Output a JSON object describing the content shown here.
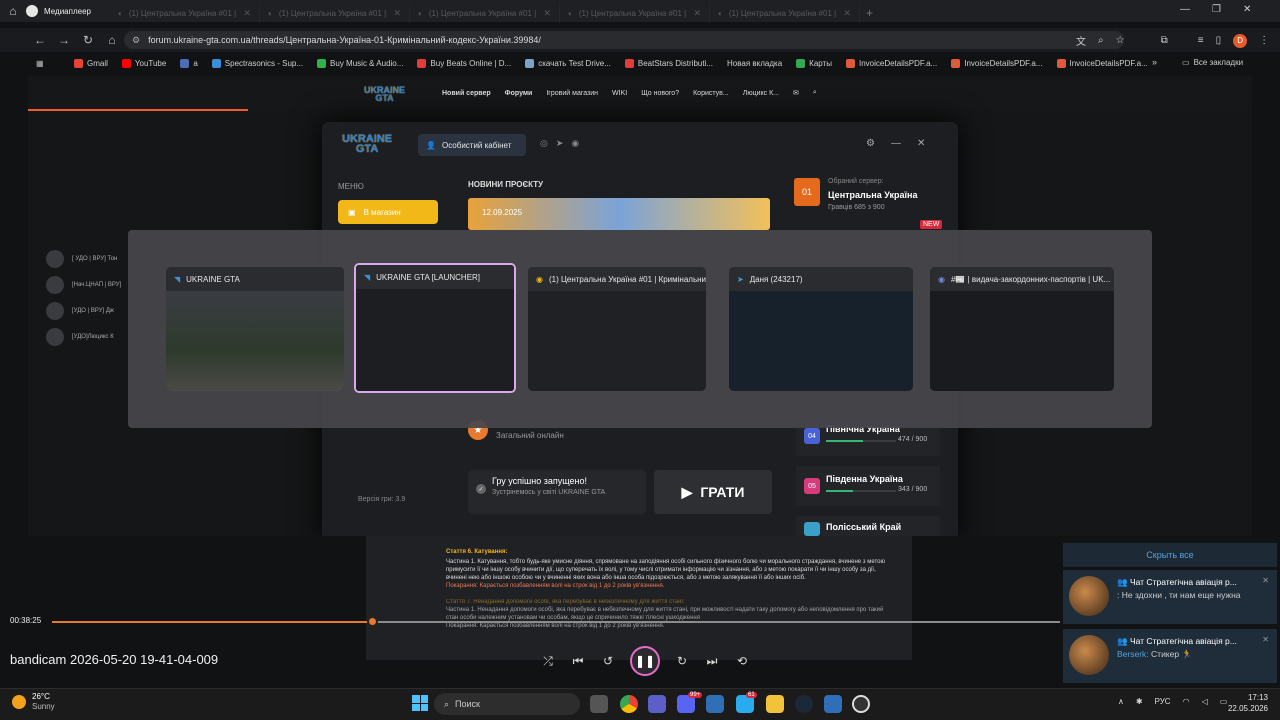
{
  "media_player": {
    "app_title": "Медиаплеер",
    "file_title": "bandicam 2026-05-20 19-41-04-009",
    "elapsed": "00:38:25",
    "progress_fraction": 0.317
  },
  "browser": {
    "tabs": [
      {
        "label": "(1) Центральна Україна #01 |"
      },
      {
        "label": "(1) Центральна Україна #01 |"
      },
      {
        "label": "(1) Центральна Україна #01 |"
      },
      {
        "label": "(1) Центральна Україна #01 |"
      },
      {
        "label": "(1) Центральна Україна #01 |"
      }
    ],
    "url": "forum.ukraine-gta.com.ua/threads/Центральна-Україна-01-Кримінальний-кодекс-України.39984/",
    "bookmarks": [
      {
        "label": "Gmail",
        "color": "#ea4335"
      },
      {
        "label": "YouTube",
        "color": "#ff0000"
      },
      {
        "label": "a",
        "color": "#4b6cb7"
      },
      {
        "label": "Spectrasonics - Sup...",
        "color": "#3a8fd8"
      },
      {
        "label": "Buy Music & Audio...",
        "color": "#2fb34a"
      },
      {
        "label": "Buy Beats Online | D...",
        "color": "#e23b3b"
      },
      {
        "label": "скачать Test Drive...",
        "color": "#7aa4c8"
      },
      {
        "label": "BeatStars Distributi...",
        "color": "#e23b3b"
      },
      {
        "label": "Новая вкладка",
        "color": ""
      },
      {
        "label": "Карты",
        "color": "#34a853"
      },
      {
        "label": "InvoiceDetailsPDF.a...",
        "color": "#e05a3a"
      },
      {
        "label": "InvoiceDetailsPDF.a...",
        "color": "#e05a3a"
      },
      {
        "label": "InvoiceDetailsPDF.a...",
        "color": "#e05a3a"
      }
    ],
    "all_bookmarks": "Все закладки",
    "profile_initial": "D"
  },
  "forum": {
    "logo_line1": "UKRAINE",
    "logo_line2": "GTA",
    "nav": [
      "Новий сервер",
      "Форуми",
      "Ігровий магазин",
      "WIKI",
      "Що нового?",
      "Користув...",
      "Люцикс К..."
    ],
    "members": [
      {
        "name": "[ УДО | ВРУ] Тон"
      },
      {
        "name": "[Нач.ЦНАП | ВРУ]"
      },
      {
        "name": "[УДО | ВРУ] Дж"
      },
      {
        "name": "[УДО]Люцикс К"
      }
    ],
    "version": "Версія гри: 3.9",
    "doc": {
      "art6_title": "Стаття 6. Катування:",
      "art6_p1": "Частина 1. Катування, тобто будь-яке умисне діяння, спрямоване на заподіяння особі сильного фізичного болю чи морального страждання, вчинене з метою примусити її чи іншу особу вчинити дії, що суперечать їх волі, у тому числі отримати інформацію чи зізнання, або з метою покарати її чи іншу особу за дії, вчинені нею або іншою особою чи у вчиненні яких вона або інша особа підозрюється, або з метою залякування її або інших осіб.",
      "art6_pen": "Покарання: Карається позбавленням волі на строк від 1 до 2 років ув'язнення.",
      "art7_title": "Стаття 7. Ненадання допомоги особі, яка перебуває в небезпечному для життя стані:",
      "art7_p1": "Частина 1. Ненадання допомоги особі, яка перебуває в небезпечному для життя стані, при можливості надати таку допомогу або неповідомлення про такий стан особи належним установам чи особам, якщо це спричинило тяжкі тілесні ушкодження",
      "art7_pen": "Покарання: Карається позбавленням волі на строк від 1 до 2 років ув'язнення."
    }
  },
  "launcher": {
    "cabinet": "Особистий кабінет",
    "menu_label": "МЕНЮ",
    "shop_button": "В магазин",
    "news_label": "НОВИНИ ПРОЄКТУ",
    "news_date": "12.09.2025",
    "selected_server_label": "Обраний сервер:",
    "selected_server_num": "01",
    "selected_server_name": "Центральна Україна",
    "players_label": "Гравців",
    "players_value": "685 з 900",
    "new_badge": "NEW",
    "online_label": "Загальний онлайн",
    "game_started": "Гру успішно запущено!",
    "game_sub": "Зустрінемось у світі UKRAINE GTA",
    "play_button": "ГРАТИ",
    "servers": [
      {
        "num": "04",
        "name": "Північна Україна",
        "players": "474",
        "max": "900",
        "color": "#4a62d8"
      },
      {
        "num": "05",
        "name": "Південна Україна",
        "players": "343",
        "max": "900",
        "color": "#d63b7c"
      },
      {
        "num": "",
        "name": "Полісський Край",
        "players": "",
        "max": "",
        "color": "#3ba0c9"
      }
    ]
  },
  "switcher": {
    "windows": [
      {
        "title": "UKRAINE GTA",
        "thumb_color": "#2e3a2c"
      },
      {
        "title": "UKRAINE GTA [LAUNCHER]",
        "thumb_color": "#1d1e22"
      },
      {
        "title": "(1) Центральна Україна #01 | Кримінальни...",
        "thumb_color": "#202124"
      },
      {
        "title": "Даня (243217)",
        "thumb_color": "#17212b"
      },
      {
        "title": "#📰 | видача-закордонних-паспортів | UK...",
        "thumb_color": "#1a1b1e"
      }
    ]
  },
  "notifications": {
    "hide_all": "Скрыть все",
    "items": [
      {
        "title": "Чат Стратегічна авіація р...",
        "sender": "",
        "text": ": Не здохни , ти нам еще нужна"
      },
      {
        "title": "Чат Стратегічна авіація р...",
        "sender": "Berserk:",
        "text": "Стикер 🏃"
      }
    ]
  },
  "taskbar": {
    "weather_temp": "26°C",
    "weather_desc": "Sunny",
    "search_placeholder": "Поиск",
    "lang": "РУС",
    "time": "17:13",
    "date": "22.05.2026",
    "badge_chrome": "",
    "badge_discord": "99+",
    "badge_telegram": "61"
  }
}
